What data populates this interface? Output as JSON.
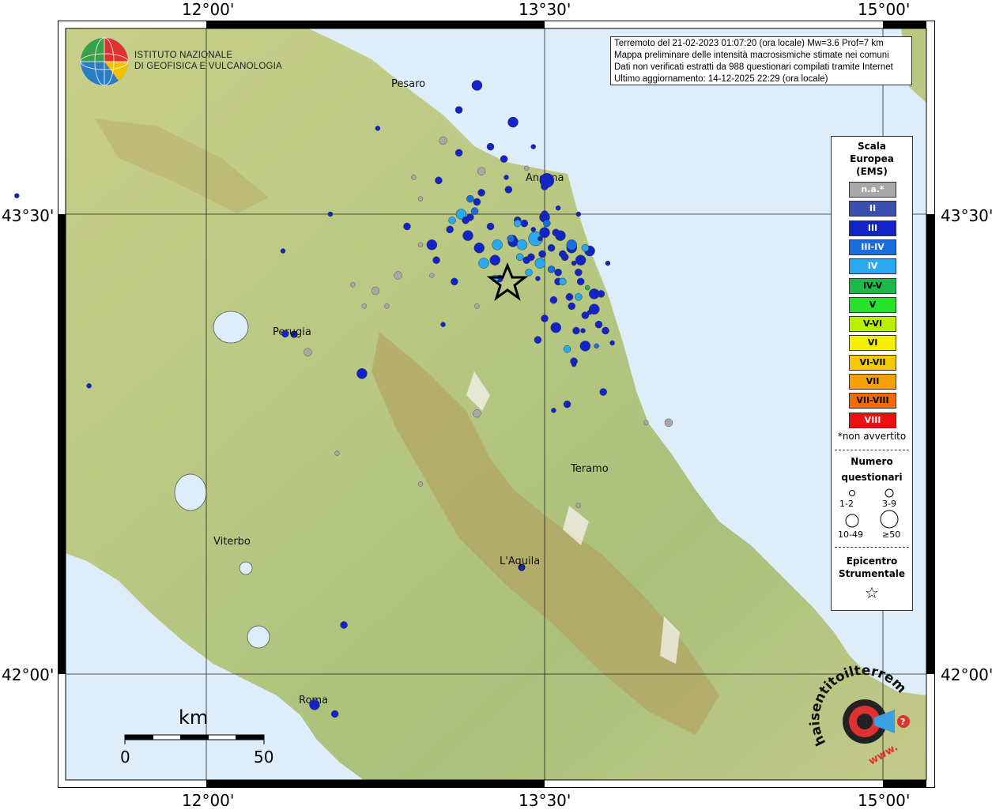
{
  "header": {
    "lines": [
      "Terremoto del 21-02-2023 01:07:20 (ora locale) Mw=3.6 Prof=7 km",
      "Mappa preliminare delle intensità macrosismiche stimate nei comuni",
      "Dati non verificati estratti da 988 questionari compilati tramite Internet",
      "Ultimo aggiornamento: 14-12-2025 22:29 (ora locale)"
    ]
  },
  "logo": {
    "line1": "ISTITUTO NAZIONALE",
    "line2": "DI GEOFISICA E VULCANOLOGIA"
  },
  "axes": {
    "lon_top": [
      "12°00'",
      "13°30'",
      "15°00'"
    ],
    "lon_bottom": [
      "12°00'",
      "13°30'",
      "15°00'"
    ],
    "lat_left": [
      "43°30'",
      "42°00'"
    ],
    "lat_right": [
      "43°30'",
      "42°00'"
    ]
  },
  "cities": [
    {
      "name": "Pesaro"
    },
    {
      "name": "Ancona"
    },
    {
      "name": "Perugia"
    },
    {
      "name": "Teramo"
    },
    {
      "name": "L'Aquila"
    },
    {
      "name": "Viterbo"
    },
    {
      "name": "Roma"
    }
  ],
  "scale_bar": {
    "unit": "km",
    "start": "0",
    "end": "50"
  },
  "legend": {
    "title": [
      "Scala",
      "Europea",
      "(EMS)"
    ],
    "classes": [
      {
        "label": "n.a.*",
        "color": "#a8a8a8",
        "text": "#ffffff"
      },
      {
        "label": "II",
        "color": "#3a4fb0",
        "text": "#ffffff"
      },
      {
        "label": "III",
        "color": "#1224c8",
        "text": "#ffffff"
      },
      {
        "label": "III-IV",
        "color": "#1a6fe0",
        "text": "#ffffff"
      },
      {
        "label": "IV",
        "color": "#2aa8f0",
        "text": "#ffffff"
      },
      {
        "label": "IV-V",
        "color": "#1db84a",
        "text": "#000000"
      },
      {
        "label": "V",
        "color": "#26e22a",
        "text": "#000000"
      },
      {
        "label": "V-VI",
        "color": "#b8f000",
        "text": "#000000"
      },
      {
        "label": "VI",
        "color": "#f5f000",
        "text": "#000000"
      },
      {
        "label": "VI-VII",
        "color": "#f5c800",
        "text": "#000000"
      },
      {
        "label": "VII",
        "color": "#f5a000",
        "text": "#000000"
      },
      {
        "label": "VII-VIII",
        "color": "#f56a00",
        "text": "#000000"
      },
      {
        "label": "VIII",
        "color": "#ee1010",
        "text": "#ffffff"
      }
    ],
    "note": "*non avvertito",
    "size_title": [
      "Numero",
      "questionari"
    ],
    "size_classes": [
      "1-2",
      "3-9",
      "10-49",
      "≥50"
    ],
    "epicenter_title": [
      "Epicentro",
      "Strumentale"
    ]
  },
  "watermark": {
    "text": "haisentitoilterremoto.it",
    "url": "www."
  },
  "intensity_points": [
    {
      "lon": 13.12,
      "lat": 43.84,
      "cls": 2,
      "n": 3
    },
    {
      "lon": 13.26,
      "lat": 43.72,
      "cls": 2,
      "n": 3
    },
    {
      "lon": 13.33,
      "lat": 43.62,
      "cls": 2,
      "n": 2
    },
    {
      "lon": 13.5,
      "lat": 43.59,
      "cls": 2,
      "n": 4
    },
    {
      "lon": 13.5,
      "lat": 43.5,
      "cls": 2,
      "n": 3
    },
    {
      "lon": 13.45,
      "lat": 43.45,
      "cls": 2,
      "n": 2
    },
    {
      "lon": 13.48,
      "lat": 43.42,
      "cls": 2,
      "n": 2
    },
    {
      "lon": 13.53,
      "lat": 43.39,
      "cls": 2,
      "n": 3
    },
    {
      "lon": 13.58,
      "lat": 43.37,
      "cls": 2,
      "n": 3
    },
    {
      "lon": 13.63,
      "lat": 43.34,
      "cls": 2,
      "n": 2
    },
    {
      "lon": 13.66,
      "lat": 43.28,
      "cls": 2,
      "n": 3
    },
    {
      "lon": 13.75,
      "lat": 43.24,
      "cls": 2,
      "n": 3
    },
    {
      "lon": 13.7,
      "lat": 43.18,
      "cls": 2,
      "n": 2
    },
    {
      "lon": 13.8,
      "lat": 43.08,
      "cls": 2,
      "n": 2
    },
    {
      "lon": 13.76,
      "lat": 42.92,
      "cls": 2,
      "n": 3
    },
    {
      "lon": 13.2,
      "lat": 43.54,
      "cls": 2,
      "n": 4
    },
    {
      "lon": 13.15,
      "lat": 43.48,
      "cls": 2,
      "n": 3
    },
    {
      "lon": 13.08,
      "lat": 43.45,
      "cls": 2,
      "n": 3
    },
    {
      "lon": 13.36,
      "lat": 43.42,
      "cls": 2,
      "n": 4
    },
    {
      "lon": 13.42,
      "lat": 43.35,
      "cls": 2,
      "n": 3
    },
    {
      "lon": 13.47,
      "lat": 43.29,
      "cls": 2,
      "n": 2
    },
    {
      "lon": 13.56,
      "lat": 43.31,
      "cls": 2,
      "n": 3
    },
    {
      "lon": 13.61,
      "lat": 43.23,
      "cls": 2,
      "n": 3
    },
    {
      "lon": 13.67,
      "lat": 43.12,
      "cls": 2,
      "n": 2
    },
    {
      "lon": 13.5,
      "lat": 43.16,
      "cls": 2,
      "n": 3
    },
    {
      "lon": 13.63,
      "lat": 43.01,
      "cls": 2,
      "n": 2
    },
    {
      "lon": 13.54,
      "lat": 42.86,
      "cls": 2,
      "n": 2
    },
    {
      "lon": 12.76,
      "lat": 43.78,
      "cls": 2,
      "n": 2
    },
    {
      "lon": 12.55,
      "lat": 43.5,
      "cls": 2,
      "n": 2
    },
    {
      "lon": 12.34,
      "lat": 43.38,
      "cls": 2,
      "n": 2
    },
    {
      "lon": 13.05,
      "lat": 43.14,
      "cls": 2,
      "n": 2
    },
    {
      "lon": 13.65,
      "lat": 43.5,
      "cls": 2,
      "n": 2
    },
    {
      "lon": 13.45,
      "lat": 43.72,
      "cls": 2,
      "n": 2
    },
    {
      "lon": 13.56,
      "lat": 43.52,
      "cls": 2,
      "n": 2
    },
    {
      "lon": 13.78,
      "lat": 43.34,
      "cls": 2,
      "n": 2
    },
    {
      "lon": 13.2,
      "lat": 43.92,
      "cls": 2,
      "n": 10
    },
    {
      "lon": 13.36,
      "lat": 43.8,
      "cls": 2,
      "n": 10
    },
    {
      "lon": 13.34,
      "lat": 43.58,
      "cls": 2,
      "n": 4
    },
    {
      "lon": 13.03,
      "lat": 43.61,
      "cls": 2,
      "n": 4
    },
    {
      "lon": 13.16,
      "lat": 43.43,
      "cls": 2,
      "n": 10
    },
    {
      "lon": 13.21,
      "lat": 43.39,
      "cls": 2,
      "n": 10
    },
    {
      "lon": 13.28,
      "lat": 43.35,
      "cls": 2,
      "n": 10
    },
    {
      "lon": 13.3,
      "lat": 43.29,
      "cls": 2,
      "n": 4
    },
    {
      "lon": 13.1,
      "lat": 43.28,
      "cls": 2,
      "n": 4
    },
    {
      "lon": 13.02,
      "lat": 43.35,
      "cls": 2,
      "n": 4
    },
    {
      "lon": 13.0,
      "lat": 43.4,
      "cls": 2,
      "n": 10
    },
    {
      "lon": 13.17,
      "lat": 43.49,
      "cls": 2,
      "n": 4
    },
    {
      "lon": 13.26,
      "lat": 43.46,
      "cls": 2,
      "n": 4
    },
    {
      "lon": 13.38,
      "lat": 43.48,
      "cls": 2,
      "n": 4
    },
    {
      "lon": 13.5,
      "lat": 43.44,
      "cls": 2,
      "n": 10
    },
    {
      "lon": 13.55,
      "lat": 43.44,
      "cls": 2,
      "n": 4
    },
    {
      "lon": 13.49,
      "lat": 43.37,
      "cls": 2,
      "n": 4
    },
    {
      "lon": 13.59,
      "lat": 43.36,
      "cls": 2,
      "n": 4
    },
    {
      "lon": 13.66,
      "lat": 43.35,
      "cls": 2,
      "n": 10
    },
    {
      "lon": 13.7,
      "lat": 43.38,
      "cls": 2,
      "n": 10
    },
    {
      "lon": 13.65,
      "lat": 43.31,
      "cls": 2,
      "n": 4
    },
    {
      "lon": 13.56,
      "lat": 43.28,
      "cls": 2,
      "n": 4
    },
    {
      "lon": 13.54,
      "lat": 43.22,
      "cls": 2,
      "n": 4
    },
    {
      "lon": 13.62,
      "lat": 43.2,
      "cls": 2,
      "n": 4
    },
    {
      "lon": 13.68,
      "lat": 43.17,
      "cls": 2,
      "n": 4
    },
    {
      "lon": 13.72,
      "lat": 43.19,
      "cls": 2,
      "n": 10
    },
    {
      "lon": 13.68,
      "lat": 43.07,
      "cls": 2,
      "n": 10
    },
    {
      "lon": 13.74,
      "lat": 43.14,
      "cls": 2,
      "n": 4
    },
    {
      "lon": 13.55,
      "lat": 43.13,
      "cls": 2,
      "n": 10
    },
    {
      "lon": 13.47,
      "lat": 43.09,
      "cls": 2,
      "n": 4
    },
    {
      "lon": 13.63,
      "lat": 43.02,
      "cls": 2,
      "n": 4
    },
    {
      "lon": 13.6,
      "lat": 42.88,
      "cls": 2,
      "n": 4
    },
    {
      "lon": 13.41,
      "lat": 43.47,
      "cls": 2,
      "n": 4
    },
    {
      "lon": 13.44,
      "lat": 43.36,
      "cls": 2,
      "n": 4
    },
    {
      "lon": 13.12,
      "lat": 43.7,
      "cls": 2,
      "n": 4
    },
    {
      "lon": 13.22,
      "lat": 43.57,
      "cls": 2,
      "n": 4
    },
    {
      "lon": 13.32,
      "lat": 43.68,
      "cls": 2,
      "n": 4
    },
    {
      "lon": 13.64,
      "lat": 43.12,
      "cls": 2,
      "n": 4
    },
    {
      "lon": 12.35,
      "lat": 43.11,
      "cls": 2,
      "n": 4
    },
    {
      "lon": 11.48,
      "lat": 42.94,
      "cls": 2,
      "n": 2
    },
    {
      "lon": 11.16,
      "lat": 43.56,
      "cls": 2,
      "n": 2
    },
    {
      "lon": 12.89,
      "lat": 43.46,
      "cls": 2,
      "n": 4
    },
    {
      "lon": 12.69,
      "lat": 42.98,
      "cls": 2,
      "n": 10
    },
    {
      "lon": 12.48,
      "lat": 41.9,
      "cls": 2,
      "n": 10
    },
    {
      "lon": 12.57,
      "lat": 41.87,
      "cls": 2,
      "n": 4
    },
    {
      "lon": 12.61,
      "lat": 42.16,
      "cls": 1,
      "n": 3
    },
    {
      "lon": 13.51,
      "lat": 43.61,
      "cls": 2,
      "n": 50
    },
    {
      "lon": 13.5,
      "lat": 43.49,
      "cls": 2,
      "n": 10
    },
    {
      "lon": 13.62,
      "lat": 43.39,
      "cls": 2,
      "n": 10
    },
    {
      "lon": 13.57,
      "lat": 43.43,
      "cls": 2,
      "n": 10
    },
    {
      "lon": 13.72,
      "lat": 43.24,
      "cls": 2,
      "n": 10
    },
    {
      "lon": 13.77,
      "lat": 43.12,
      "cls": 2,
      "n": 4
    },
    {
      "lon": 13.36,
      "lat": 43.41,
      "cls": 1,
      "n": 10
    },
    {
      "lon": 13.19,
      "lat": 43.51,
      "cls": 3,
      "n": 4
    },
    {
      "lon": 13.17,
      "lat": 43.55,
      "cls": 3,
      "n": 4
    },
    {
      "lon": 13.35,
      "lat": 43.42,
      "cls": 3,
      "n": 4
    },
    {
      "lon": 13.51,
      "lat": 43.47,
      "cls": 3,
      "n": 4
    },
    {
      "lon": 13.53,
      "lat": 43.32,
      "cls": 3,
      "n": 4
    },
    {
      "lon": 13.62,
      "lat": 43.4,
      "cls": 3,
      "n": 10
    },
    {
      "lon": 13.73,
      "lat": 43.07,
      "cls": 3,
      "n": 2
    },
    {
      "lon": 13.29,
      "lat": 43.4,
      "cls": 4,
      "n": 10
    },
    {
      "lon": 13.13,
      "lat": 43.5,
      "cls": 4,
      "n": 10
    },
    {
      "lon": 13.39,
      "lat": 43.36,
      "cls": 4,
      "n": 4
    },
    {
      "lon": 13.48,
      "lat": 43.34,
      "cls": 4,
      "n": 10
    },
    {
      "lon": 13.46,
      "lat": 43.42,
      "cls": 4,
      "n": 50
    },
    {
      "lon": 13.4,
      "lat": 43.4,
      "cls": 4,
      "n": 10
    },
    {
      "lon": 13.23,
      "lat": 43.34,
      "cls": 4,
      "n": 10
    },
    {
      "lon": 13.28,
      "lat": 43.29,
      "cls": 4,
      "n": 4
    },
    {
      "lon": 13.43,
      "lat": 43.31,
      "cls": 4,
      "n": 4
    },
    {
      "lon": 13.38,
      "lat": 43.47,
      "cls": 4,
      "n": 4
    },
    {
      "lon": 13.58,
      "lat": 43.28,
      "cls": 4,
      "n": 4
    },
    {
      "lon": 13.68,
      "lat": 43.39,
      "cls": 4,
      "n": 4
    },
    {
      "lon": 13.65,
      "lat": 43.23,
      "cls": 4,
      "n": 4
    },
    {
      "lon": 13.6,
      "lat": 43.06,
      "cls": 4,
      "n": 4
    },
    {
      "lon": 13.09,
      "lat": 43.48,
      "cls": 4,
      "n": 4
    },
    {
      "lon": 13.69,
      "lat": 43.26,
      "cls": 5,
      "n": 2
    }
  ]
}
